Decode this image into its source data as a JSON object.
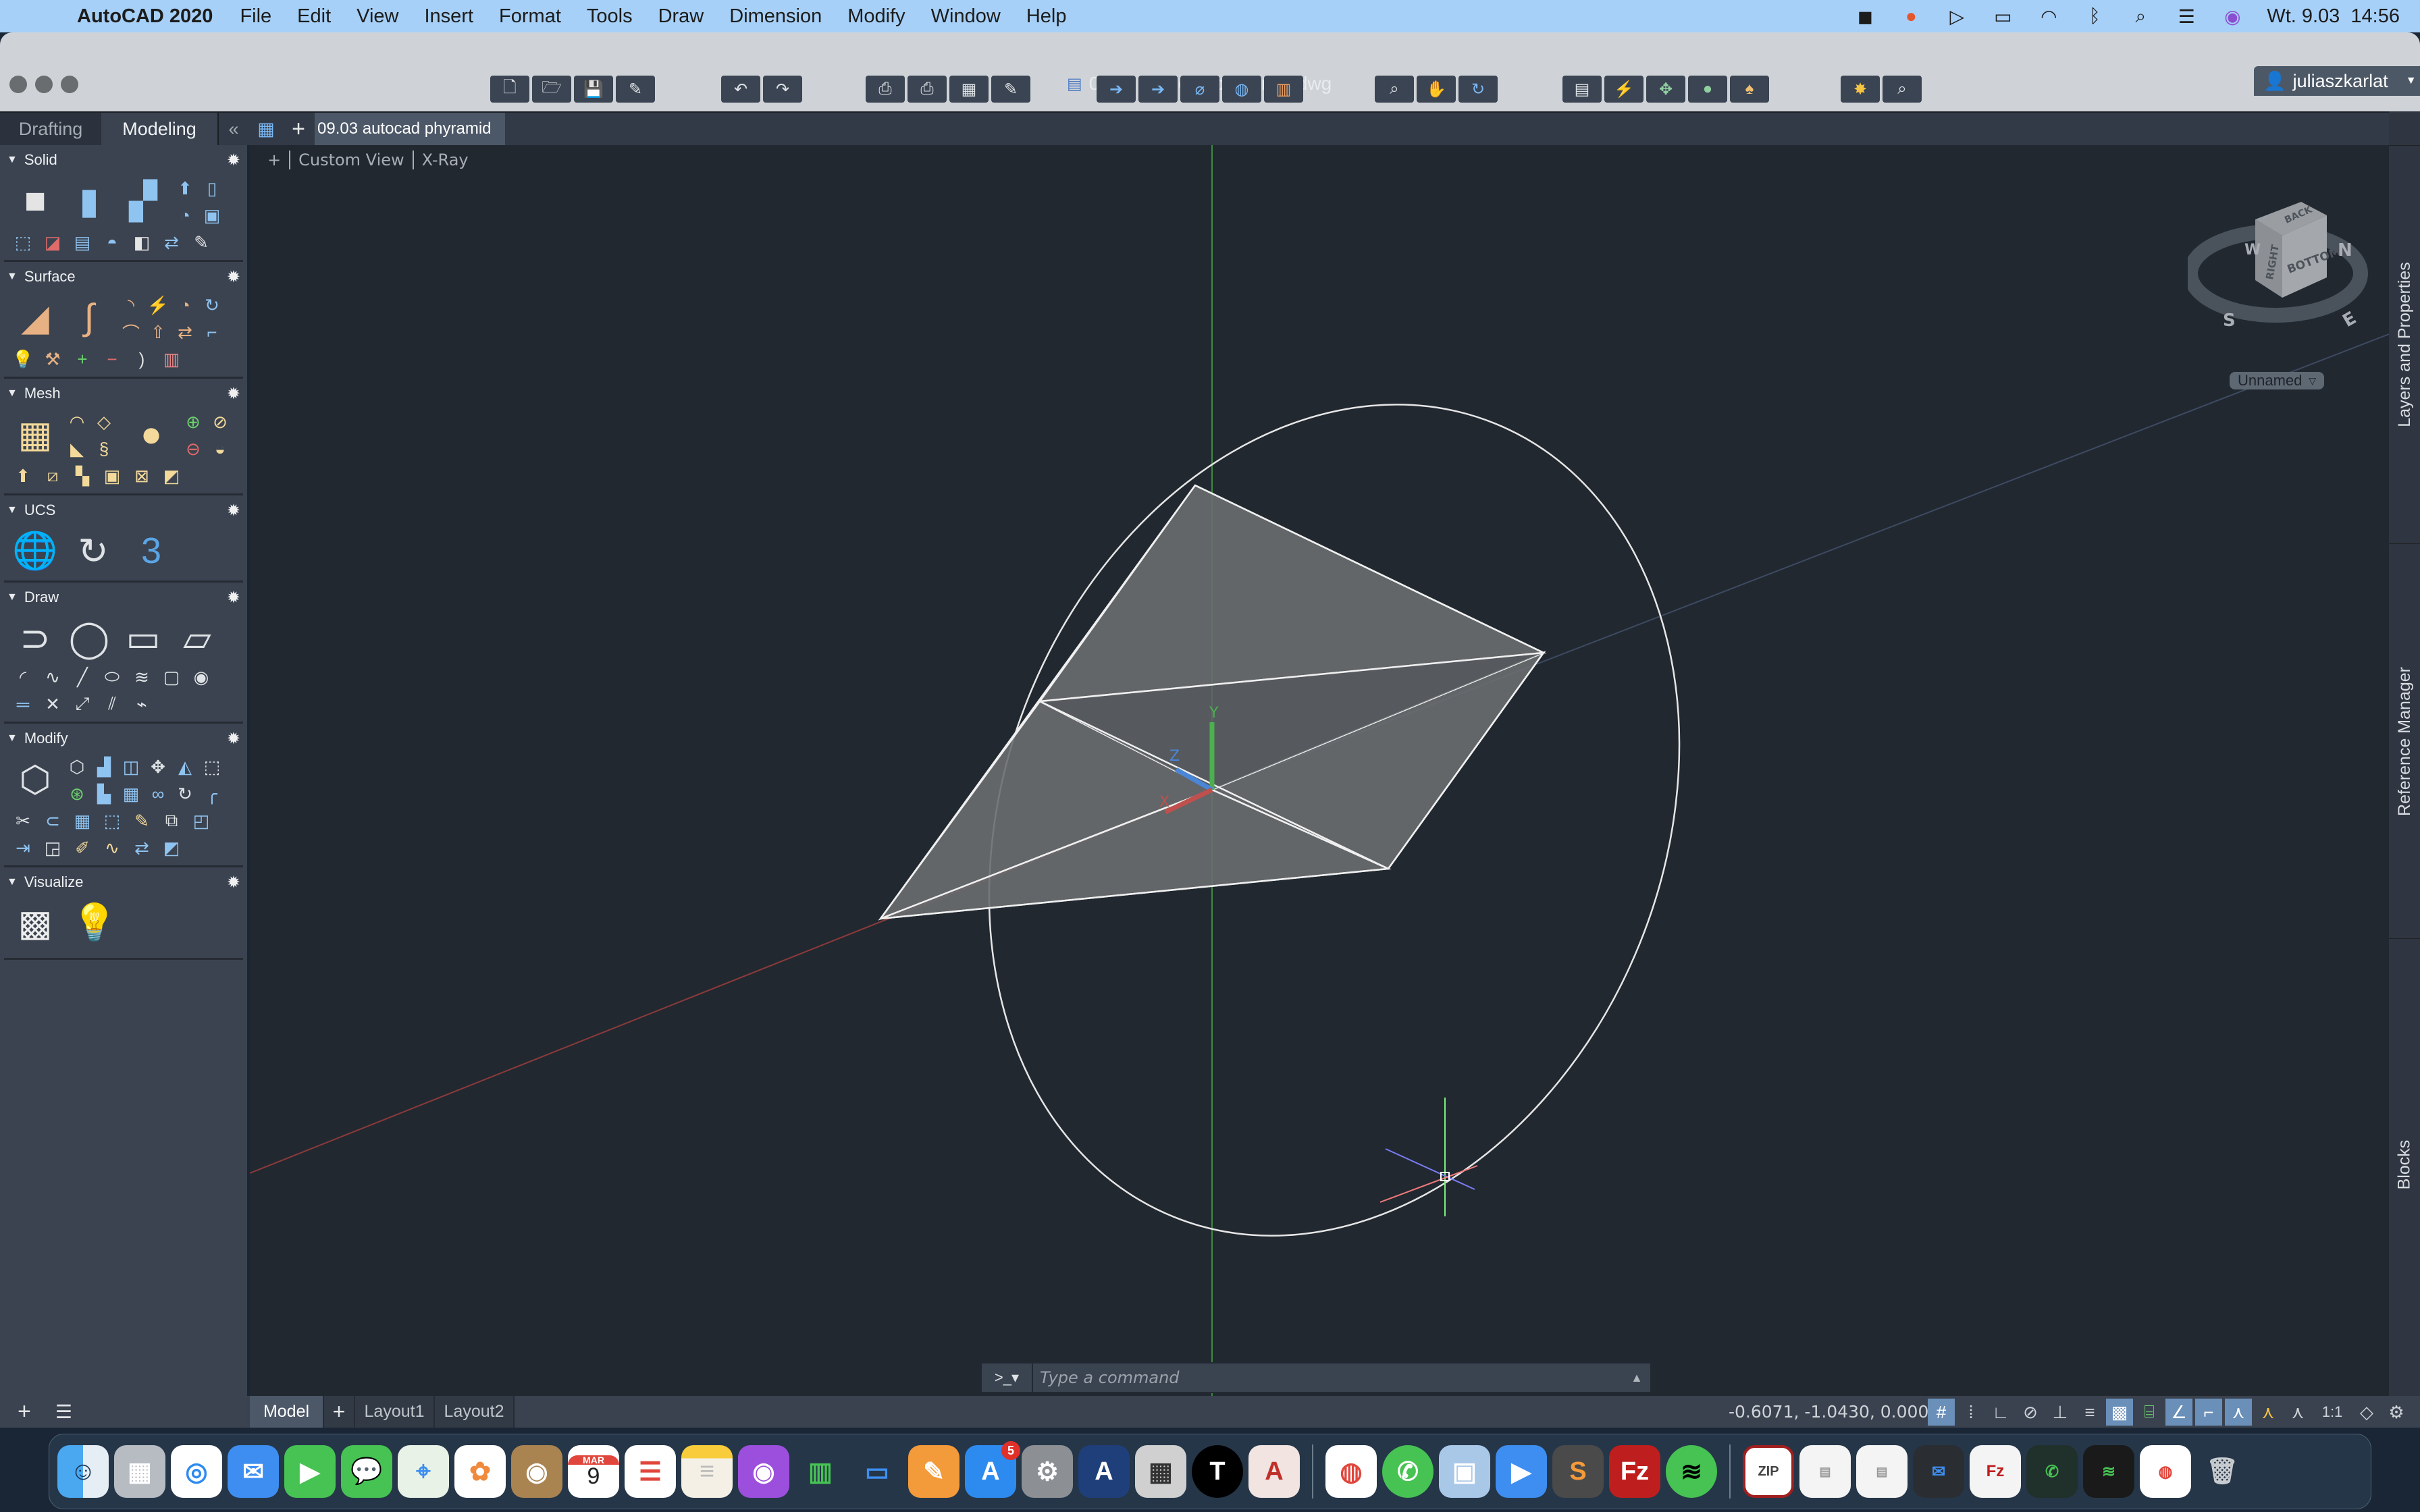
{
  "menubar": {
    "app_name": "AutoCAD 2020",
    "items": [
      "File",
      "Edit",
      "View",
      "Insert",
      "Format",
      "Tools",
      "Draw",
      "Dimension",
      "Modify",
      "Window",
      "Help"
    ],
    "status_icons": [
      "screen-record-icon",
      "creative-cloud-icon",
      "play-icon",
      "battery-icon",
      "wifi-icon",
      "bluetooth-icon",
      "spotlight-search-icon",
      "control-center-icon",
      "siri-icon"
    ],
    "clock": "Wt. 9.03  14:56"
  },
  "window": {
    "title": "09.03 autocad phyramid.dwg",
    "user": "juliaszkarlat"
  },
  "toolbar": {
    "groups": [
      [
        "new-icon",
        "open-icon",
        "save-icon",
        "save-as-icon"
      ],
      [
        "undo-icon",
        "redo-icon"
      ],
      [
        "plot-icon",
        "batch-plot-icon",
        "page-setup-icon",
        "edit-page-setup-icon"
      ],
      [
        "import-icon",
        "export-icon",
        "attach-icon",
        "publish-web-icon",
        "layer-state-icon"
      ],
      [
        "zoom-window-icon",
        "pan-icon",
        "orbit-icon"
      ],
      [
        "properties-icon",
        "quick-select-icon",
        "match-properties-icon",
        "isolate-icon",
        "purge-icon"
      ],
      [
        "render-icon",
        "design-center-icon"
      ]
    ]
  },
  "workspace_tabs": {
    "drafting": "Drafting",
    "modeling": "Modeling",
    "active": "Modeling"
  },
  "doc_tab": {
    "label": "09.03 autocad phyramid"
  },
  "palette": {
    "sections": [
      {
        "title": "Solid"
      },
      {
        "title": "Surface"
      },
      {
        "title": "Mesh"
      },
      {
        "title": "UCS"
      },
      {
        "title": "Draw"
      },
      {
        "title": "Modify"
      },
      {
        "title": "Visualize"
      }
    ]
  },
  "viewport": {
    "view_name": "Custom View",
    "visual_style": "X-Ray",
    "named_view": "Unnamed",
    "viewcube_faces": {
      "top": "BACK",
      "left": "RIGHT",
      "right": "BOTTOM"
    },
    "compass": {
      "n": "N",
      "s": "S",
      "e": "E",
      "w": "W"
    },
    "ucs_axes": {
      "x": "X",
      "y": "Y",
      "z": "Z"
    }
  },
  "right_dock": {
    "tabs": [
      "Layers and Properties",
      "Reference Manager",
      "Blocks"
    ]
  },
  "command_line": {
    "prompt_icon": ">_▾",
    "placeholder": "Type a command"
  },
  "layout_tabs": {
    "items": [
      "Model",
      "Layout1",
      "Layout2"
    ],
    "active": "Model"
  },
  "statusbar": {
    "coordinates": "-0.6071, -1.0430, 0.0000",
    "annotation_scale": "1:1",
    "toggles": [
      {
        "name": "grid",
        "on": true
      },
      {
        "name": "snap",
        "on": false
      },
      {
        "name": "ortho",
        "on": false
      },
      {
        "name": "polar",
        "on": false
      },
      {
        "name": "object-snap-tracking",
        "on": false
      },
      {
        "name": "lineweight",
        "on": false
      },
      {
        "name": "transparency",
        "on": true
      },
      {
        "name": "selection-cycling",
        "on": false
      },
      {
        "name": "3d-object-snap",
        "on": true
      },
      {
        "name": "dynamic-ucs",
        "on": true
      },
      {
        "name": "annotation-visibility",
        "on": true
      },
      {
        "name": "auto-scale",
        "on": false
      },
      {
        "name": "annotation-scale",
        "on": false
      }
    ]
  },
  "dock": {
    "apps": [
      "Finder",
      "Launchpad",
      "Safari",
      "Mail",
      "FaceTime",
      "Messages",
      "Maps",
      "Photos",
      "Contacts",
      "Calendar",
      "Reminders",
      "Notes",
      "Podcasts",
      "Numbers",
      "Keynote",
      "Pages",
      "App Store",
      "System Preferences",
      "AutoCAD EDU",
      "Calculator",
      "Typora",
      "AutoCAD",
      "Chrome",
      "WhatsApp",
      "Preview",
      "Zoom",
      "Sublime Text",
      "FileZilla",
      "Spotify"
    ],
    "calendar_month": "MAR",
    "calendar_day": "9",
    "app_store_badge": "5"
  }
}
